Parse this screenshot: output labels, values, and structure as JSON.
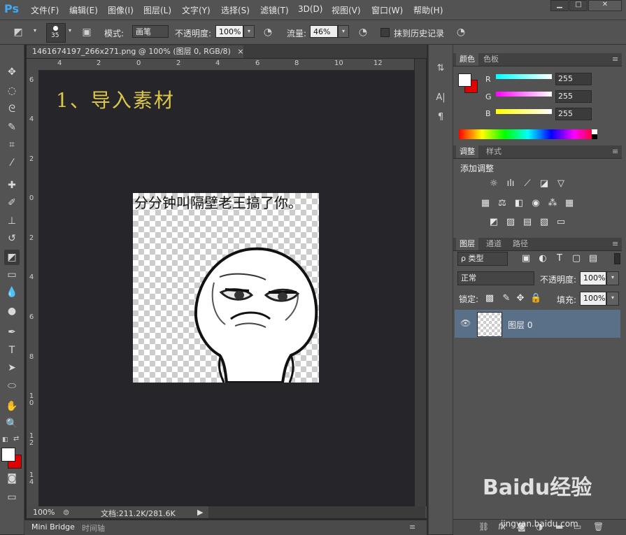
{
  "app": {
    "logo": "Ps"
  },
  "menu": [
    "文件(F)",
    "编辑(E)",
    "图像(I)",
    "图层(L)",
    "文字(Y)",
    "选择(S)",
    "滤镜(T)",
    "3D(D)",
    "视图(V)",
    "窗口(W)",
    "帮助(H)"
  ],
  "window_controls": {
    "minimize": "▁",
    "maximize": "□",
    "close": "✕"
  },
  "options": {
    "brush_size": "35",
    "mode_label": "模式:",
    "mode_value": "画笔",
    "opacity_label": "不透明度:",
    "opacity_value": "100%",
    "flow_label": "流量:",
    "flow_value": "46%",
    "erase_history_label": "抹到历史记录"
  },
  "document": {
    "tab_title": "1461674197_266x271.png @ 100% (图层 0, RGB/8)",
    "tab_close": "×",
    "heading": "1、导入素材",
    "image_caption": "分分钟叫隔壁老王搞了你。",
    "ruler_top": [
      "4",
      "2",
      "0",
      "2",
      "4",
      "6",
      "8",
      "10",
      "12"
    ],
    "ruler_left": [
      "6",
      "4",
      "2",
      "0",
      "2",
      "4",
      "6",
      "8",
      "1 0",
      "1 2",
      "1 4"
    ]
  },
  "status": {
    "zoom": "100%",
    "doc_info": "文档:211.2K/281.6K",
    "arrow": "▶"
  },
  "bottom_tabs": [
    "Mini Bridge",
    "时间轴"
  ],
  "color_panel": {
    "tabs": [
      "颜色",
      "色板"
    ],
    "channels": [
      {
        "label": "R",
        "value": "255"
      },
      {
        "label": "G",
        "value": "255"
      },
      {
        "label": "B",
        "value": "255"
      }
    ],
    "foreground": "#ffffff",
    "background": "#e00000"
  },
  "adjustments_panel": {
    "tabs": [
      "调整",
      "样式"
    ],
    "title": "添加调整"
  },
  "layers_panel": {
    "tabs": [
      "图层",
      "通道",
      "路径"
    ],
    "filter_label": "ρ 类型",
    "blend_mode": "正常",
    "opacity_label": "不透明度:",
    "opacity_value": "100%",
    "lock_label": "锁定:",
    "fill_label": "填充:",
    "fill_value": "100%",
    "layer_name": "图层 0"
  },
  "watermark": {
    "brand": "Baidu经验",
    "url": "jingyan.baidu.com"
  }
}
